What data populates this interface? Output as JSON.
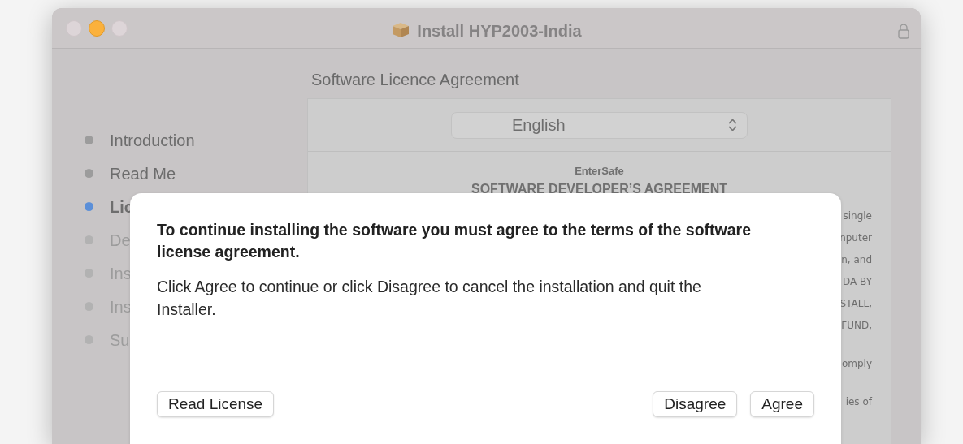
{
  "window": {
    "title": "Install HYP2003-India",
    "traffic_lights": [
      {
        "active": false
      },
      {
        "active": true
      },
      {
        "active": false
      }
    ],
    "locked": true
  },
  "sidebar": {
    "items": [
      {
        "label": "Introduction",
        "selected": false,
        "completed": true
      },
      {
        "label": "Read Me",
        "selected": false,
        "completed": true
      },
      {
        "label": "Lic",
        "selected": true,
        "completed": false
      },
      {
        "label": "De",
        "selected": false,
        "completed": false
      },
      {
        "label": "Ins",
        "selected": false,
        "completed": false
      },
      {
        "label": "Ins",
        "selected": false,
        "completed": false
      },
      {
        "label": "Su",
        "selected": false,
        "completed": false
      }
    ]
  },
  "page_title": "Software Licence Agreement",
  "language_select": {
    "value": "English"
  },
  "license": {
    "company": "EnterSafe",
    "heading": "SOFTWARE DEVELOPER’S AGREEMENT",
    "paragraphs": [
      {
        "lines": [
          "single",
          "nputer",
          "n, and",
          "DA BY",
          "STALL,",
          "FUND,"
        ]
      },
      {
        "lines": [
          "omply"
        ]
      },
      {
        "lines": [
          "ies of"
        ]
      }
    ]
  },
  "dialog": {
    "title": "To continue installing the software you must agree to the terms of the software license agreement.",
    "message": "Click Agree to continue or click Disagree to cancel the installation and quit the Installer.",
    "left_buttons": [
      "Read License"
    ],
    "right_buttons": [
      "Disagree",
      "Agree"
    ]
  }
}
